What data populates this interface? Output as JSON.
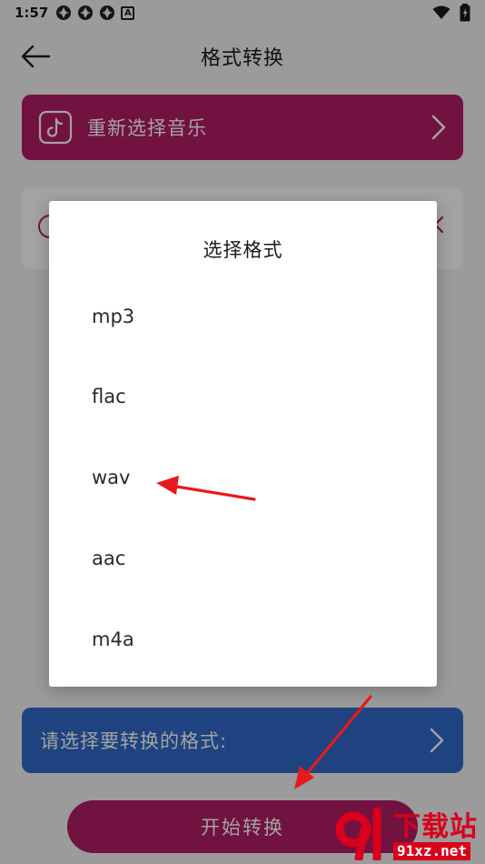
{
  "status_bar": {
    "time": "1:57",
    "a_badge": "A"
  },
  "app_bar": {
    "title": "格式转换"
  },
  "music_card": {
    "label": "重新选择音乐"
  },
  "format_card": {
    "label": "请选择要转换的格式:"
  },
  "start_button": {
    "label": "开始转换"
  },
  "dialog": {
    "title": "选择格式",
    "options": [
      "mp3",
      "flac",
      "wav",
      "aac",
      "m4a"
    ]
  },
  "watermark": {
    "brand_cn": "下载站",
    "url": "91xz.net"
  },
  "colors": {
    "primary": "#b21d66",
    "accent_blue": "#2f69c8",
    "arrow": "#e8191a"
  }
}
